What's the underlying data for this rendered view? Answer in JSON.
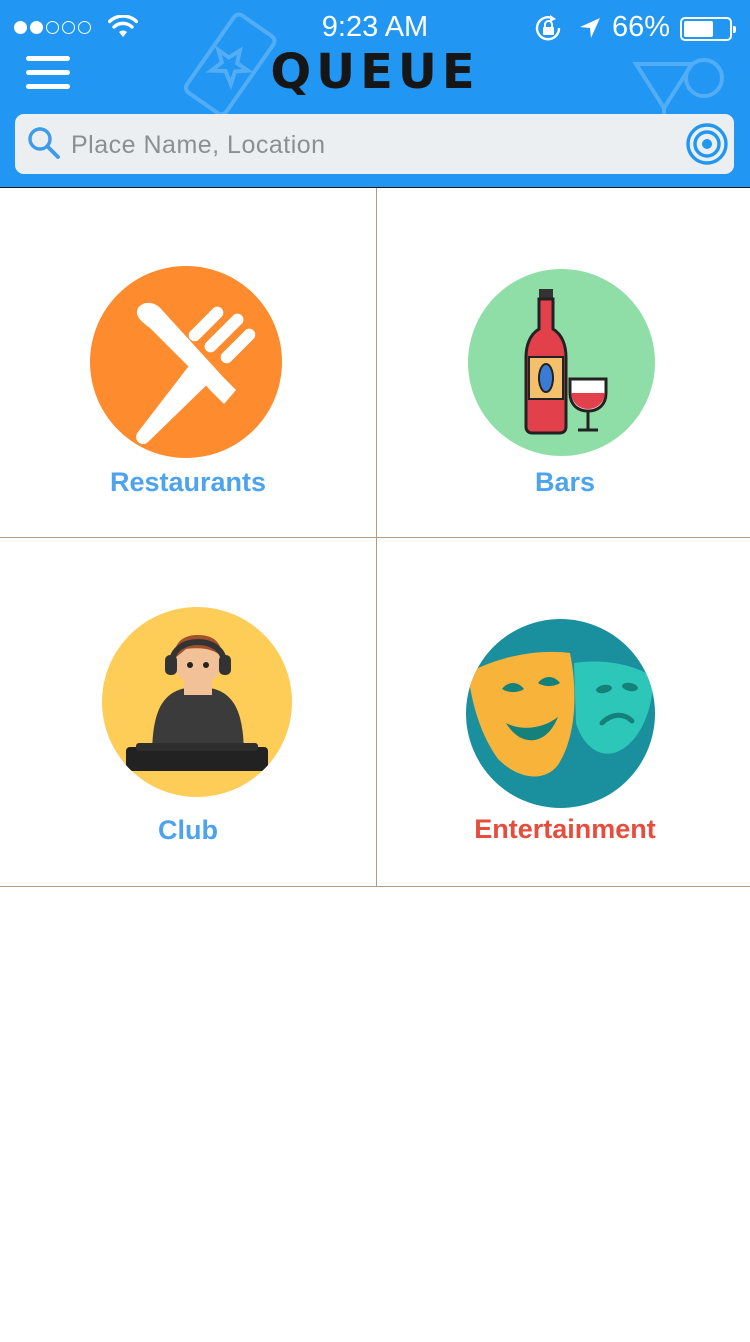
{
  "status_bar": {
    "time": "9:23 AM",
    "battery_percent": "66%",
    "battery_level": 0.66,
    "signal_bars_filled": 2,
    "signal_bars_total": 5
  },
  "header": {
    "app_title": "QUEUE",
    "menu_icon": "hamburger-menu-icon",
    "background_color": "#2196f3"
  },
  "search": {
    "placeholder": "Place Name, Location",
    "value": "",
    "search_icon": "search-icon",
    "locate_icon": "target-location-icon"
  },
  "categories": [
    {
      "label": "Restaurants",
      "icon": "knife-fork-icon",
      "circle_color": "#fe8b2e",
      "label_color": "#4da3ec"
    },
    {
      "label": "Bars",
      "icon": "wine-bottle-glass-icon",
      "circle_color": "#8fdea7",
      "label_color": "#4da3ec"
    },
    {
      "label": "Club",
      "icon": "dj-icon",
      "circle_color": "#fecd58",
      "label_color": "#4da3ec"
    },
    {
      "label": "Entertainment",
      "icon": "theater-masks-icon",
      "circle_color": "#1a8f9d",
      "label_color": "#e74c3c"
    }
  ]
}
